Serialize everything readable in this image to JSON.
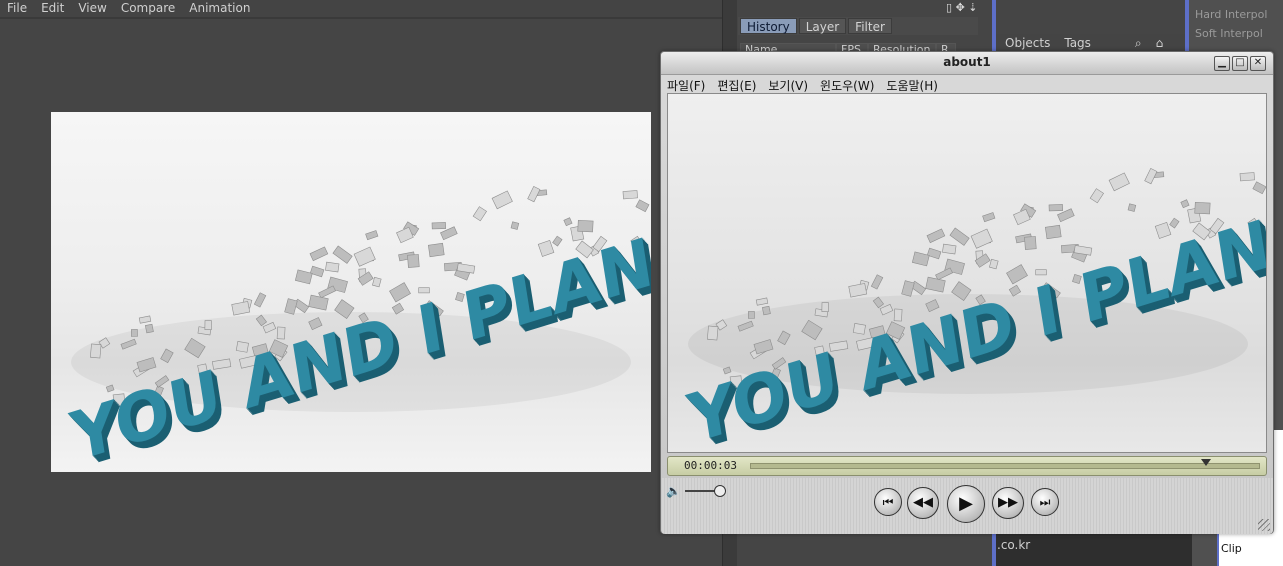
{
  "menubar": {
    "items": [
      "File",
      "Edit",
      "View",
      "Compare",
      "Animation"
    ]
  },
  "panel_tabs": [
    "History",
    "Layer",
    "Filter"
  ],
  "panel_columns": [
    "Name",
    "FPS",
    "Resolution",
    "R"
  ],
  "objects_panel": {
    "tabs": [
      "Objects",
      "Tags"
    ]
  },
  "right_col": {
    "items": [
      "Hard Interpol",
      "Soft Interpol"
    ]
  },
  "bottom": {
    "domain": ".co.kr",
    "clip": "Clip"
  },
  "player": {
    "title": "about1",
    "menu": [
      "파일(F)",
      "편집(E)",
      "보기(V)",
      "윈도우(W)",
      "도움말(H)"
    ],
    "timecode": "00:00:03",
    "playhead_fraction": 0.895,
    "volume_fraction": 0.85
  },
  "scene": {
    "text": "YOU AND I PLANE",
    "color": "#2e8aa3",
    "ground": "#e9e9e9"
  },
  "colors": {
    "app_bg": "#454545",
    "accent_blue": "#5d6fc8",
    "tab_active": "#8a9cb8"
  }
}
